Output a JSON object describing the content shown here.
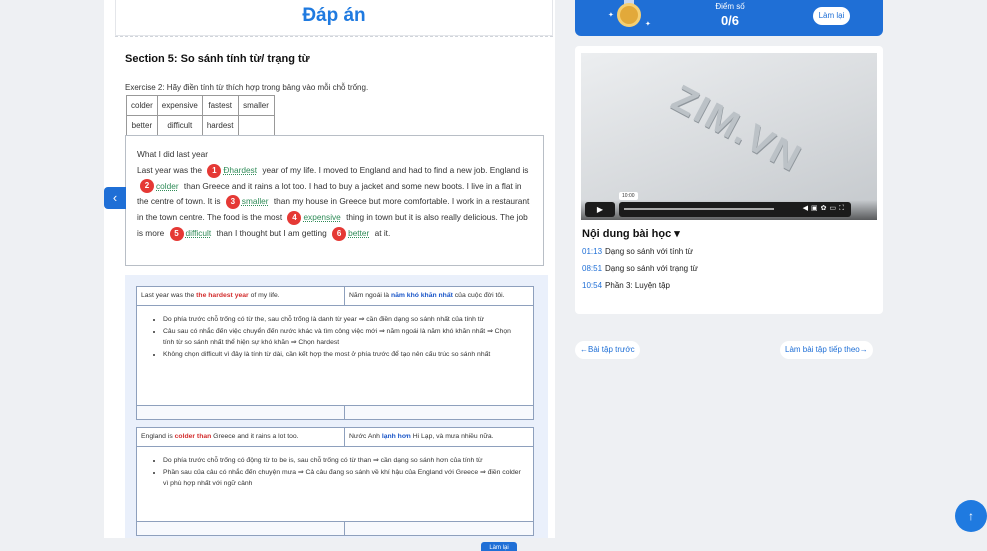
{
  "main": {
    "title": "Đáp án",
    "section": "Section 5: So sánh tính từ/ trạng từ",
    "exercise": "Exercise 2: Hãy điền tính từ thích hợp trong bảng vào mỗi chỗ trống.",
    "word_table": [
      [
        "colder",
        "expensive",
        "fastest",
        "smaller"
      ],
      [
        "better",
        "difficult",
        "hardest",
        ""
      ]
    ],
    "passage": {
      "heading": "What I did last year",
      "p1": "Last year was the",
      "a1": "Đhardest",
      "p2": "year of my life. I moved to England and had to find a new job. England is",
      "a2": "colder",
      "p3": "than Greece and it rains a lot too. I had to buy a jacket and some new boots. I live in a flat in the centre of town. It is",
      "a3": "smaller",
      "p4": "than my house in Greece but more comfortable. I work in a restaurant in the town centre. The food is the most",
      "a4": "expensive",
      "p5": "thing in town but it is also really delicious. The job is more",
      "a5": "difficult",
      "p6": "than I thought but I am getting",
      "a6": "better",
      "p7": "at it.",
      "n1": "1",
      "n2": "2",
      "n3": "3",
      "n4": "4",
      "n5": "5",
      "n6": "6"
    },
    "explain1": {
      "en_a": "Last year was the ",
      "en_hl": "the hardest year",
      "en_b": " of my life.",
      "vi_a": "Năm ngoái là ",
      "vi_hl": "năm khó khăn nhất",
      "vi_b": " của cuộc đời tôi.",
      "b1": "Do phía trước chỗ trống có từ the, sau chỗ trống là danh từ year ⇒ cần điền dạng so sánh nhất của tính từ",
      "b2": "Câu sau có nhắc đến việc chuyển đến nước khác và tìm công việc mới ⇒ năm ngoái là năm khó khăn nhất ⇒ Chọn tính từ so sánh nhất thể hiện sự khó khăn ⇒ Chọn hardest",
      "b3": "Không chọn difficult vì đây là tính từ dài, cần kết hợp the most ở phía trước để tạo nên cấu trúc so sánh nhất"
    },
    "explain2": {
      "en_a": "England is ",
      "en_hl": "colder than",
      "en_b": " Greece and it rains a lot too.",
      "vi_a": "Nước Anh ",
      "vi_hl": "lạnh hơn",
      "vi_b": " Hi Lạp, và mưa nhiều nữa.",
      "b1": "Do phía trước chỗ trống có động từ to be is, sau chỗ trống có từ than ⇒ cần dạng so sánh hơn của tính từ",
      "b2": "Phần sau của câu có nhắc đến chuyện mưa ⇒ Cả câu đang so sánh về khí hậu của England với Greece ⇒ điền colder vì phù hợp nhất với ngữ cảnh"
    }
  },
  "score": {
    "label": "Điểm số",
    "value": "0/6",
    "retry": "Làm lại"
  },
  "video": {
    "watermark": "ZIM.VN",
    "time_tip": "10:00"
  },
  "lessons": {
    "title": "Nội dung bài học",
    "items": [
      {
        "time": "01:13",
        "label": "Dạng so sánh với tính từ"
      },
      {
        "time": "08:51",
        "label": "Dạng so sánh với trạng từ"
      },
      {
        "time": "10:54",
        "label": "Phần 3: Luyện tập"
      }
    ]
  },
  "nav": {
    "prev": "←Bài tập trước",
    "next": "Làm bài tập tiếp theo→"
  },
  "bottom_button": "Làm lại",
  "colors": {
    "primary": "#1f6fd6",
    "answer": "#2e8b57",
    "badge": "#e53935"
  }
}
